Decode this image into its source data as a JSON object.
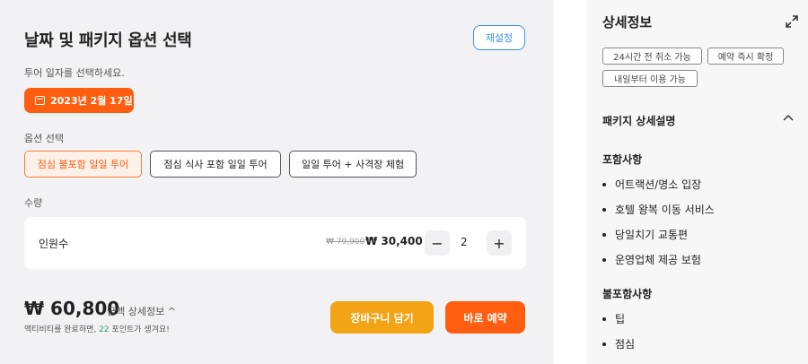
{
  "main": {
    "title": "날짜 및 패키지 옵션 선택",
    "reset_label": "재설정",
    "date_hint": "투어 일자를 선택하세요.",
    "date_value": "2023년 2월 17일",
    "options_label": "옵션 선택",
    "options": [
      {
        "label": "점심 불포함 일일 투어",
        "selected": true
      },
      {
        "label": "점심 식사 포함 일일 투어",
        "selected": false
      },
      {
        "label": "일일 투어 + 사격장 체험",
        "selected": false
      }
    ],
    "quantity_label": "수량",
    "quantity": {
      "name": "인원수",
      "old_price": "₩ 79,900",
      "new_price": "₩ 30,400",
      "minus": "−",
      "plus": "+",
      "value": "2"
    },
    "total": "₩ 60,800",
    "detail_link": "금액 상세정보 ^",
    "points_prefix": "액티비티를 완료하면, ",
    "points_value": "22",
    "points_suffix": " 포인트가 생겨요!",
    "cart_label": "장바구니 담기",
    "book_label": "바로 예약",
    "accent": "#ff5d0f",
    "cart_color": "#f2a316"
  },
  "sidebar": {
    "title": "상세정보",
    "tags": [
      "24시간 전 취소 가능",
      "예약 즉시 확정",
      "내일부터 이용 가능"
    ],
    "section_title": "패키지 상세설명",
    "included_title": "포함사항",
    "included": [
      "어트랙션/명소 입장",
      "호텔 왕복 이동 서비스",
      "당일치기 교통편",
      "운영업체 제공 보험"
    ],
    "excluded_title": "불포함사항",
    "excluded": [
      "팁",
      "점심"
    ]
  }
}
